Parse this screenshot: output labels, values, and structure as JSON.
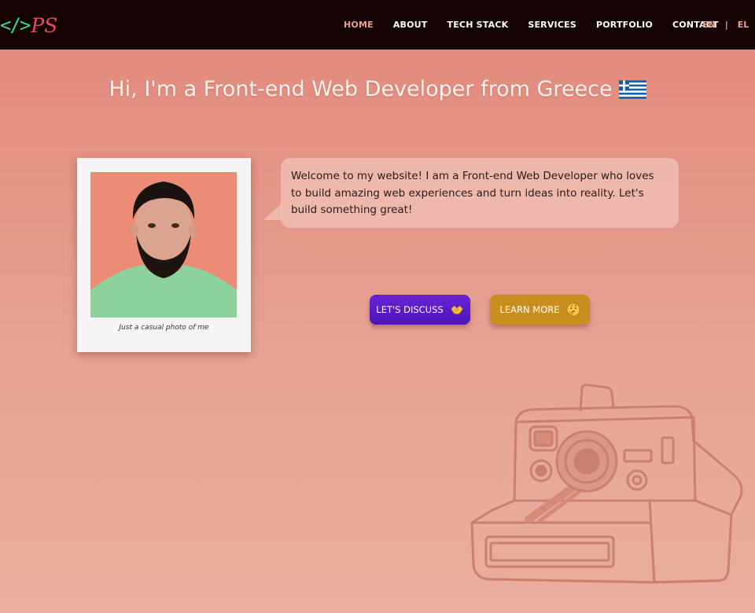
{
  "navbar": {
    "logo_code": "</>",
    "logo_initials": "PS",
    "links": [
      {
        "label": "HOME",
        "active": true
      },
      {
        "label": "ABOUT",
        "active": false
      },
      {
        "label": "TECH STACK",
        "active": false
      },
      {
        "label": "SERVICES",
        "active": false
      },
      {
        "label": "PORTFOLIO",
        "active": false
      },
      {
        "label": "CONTACT",
        "active": false
      }
    ],
    "lang": {
      "en": "EN",
      "separator": "|",
      "el": "EL"
    }
  },
  "hero": {
    "title": "Hi, I'm a Front-end Web Developer from Greece",
    "flag_icon": "greece-flag-icon"
  },
  "polaroid": {
    "caption": "Just a casual photo of me"
  },
  "bubble": {
    "text": "Welcome to my website! I am a Front-end Web Developer who loves to build amazing web experiences and turn ideas into reality. Let's build something great!"
  },
  "buttons": {
    "discuss_label": "LET'S DISCUSS",
    "discuss_icon": "handshake-emoji-icon",
    "learn_label": "LEARN MORE",
    "learn_icon": "thinking-face-emoji-icon"
  },
  "colors": {
    "nav_bg": "#150304",
    "accent": "#e8a08f",
    "discuss_bg": "#5a1bc8",
    "learn_bg": "#c98f1e"
  }
}
